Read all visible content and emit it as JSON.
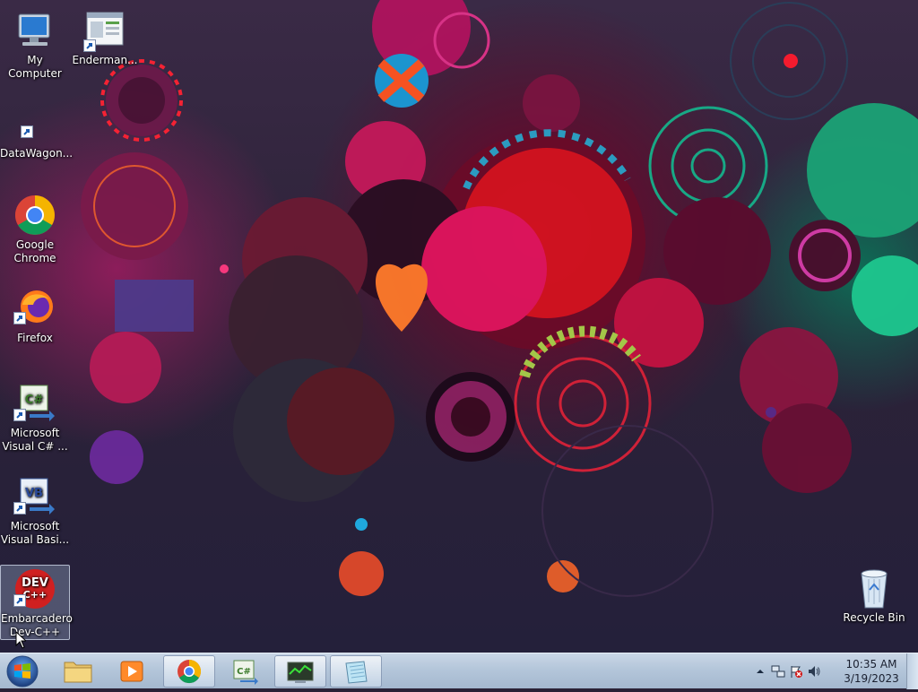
{
  "desktop_icons": {
    "my_computer": "My Computer",
    "enderman": "Enderman...",
    "datawagon": "DataWagon...",
    "chrome": "Google Chrome",
    "firefox": "Firefox",
    "vcsharp": "Microsoft Visual C# ...",
    "vbasic": "Microsoft Visual Basi...",
    "devcpp": "Embarcadero Dev-C++",
    "recycle_bin": "Recycle Bin"
  },
  "taskbar": {
    "pinned": [
      "start-button",
      "explorer",
      "media-player",
      "chrome",
      "visual-csharp",
      "task-manager",
      "notepad"
    ],
    "active": [
      "chrome",
      "task-manager",
      "notepad"
    ]
  },
  "tray": {
    "time": "10:35 AM",
    "date": "3/19/2023",
    "icons": [
      "show-hidden-icons-arrow",
      "network-icon",
      "action-center-flag-icon",
      "volume-icon"
    ]
  },
  "colors": {
    "accent": "#3a6ea5",
    "taskbar": "#b4c6da",
    "selection": "#a0b4d2"
  }
}
